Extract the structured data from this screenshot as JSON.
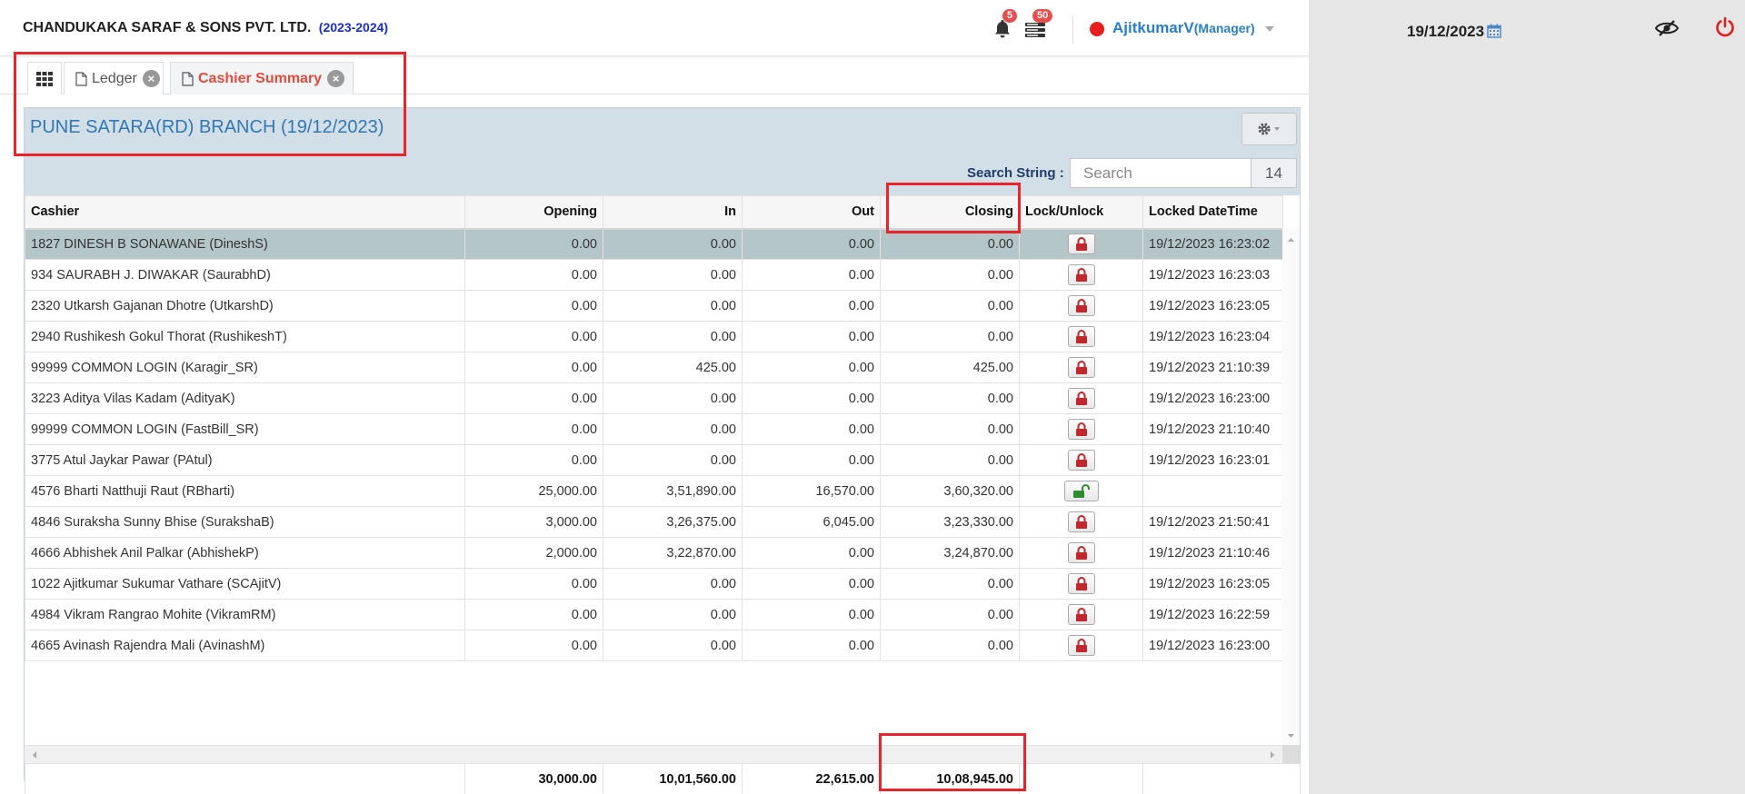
{
  "header": {
    "company": "CHANDUKAKA SARAF & SONS PVT. LTD.",
    "year": "(2023-2024)",
    "notifications_count": "5",
    "messages_count": "50",
    "user_name": "AjitkumarV",
    "user_role": "(Manager)"
  },
  "right_pane": {
    "date": "19/12/2023"
  },
  "tabs": [
    {
      "label": ""
    },
    {
      "label": "Ledger"
    },
    {
      "label": "Cashier Summary"
    }
  ],
  "panel": {
    "title": "PUNE SATARA(RD) BRANCH (19/12/2023)",
    "search_label": "Search String :",
    "search_placeholder": "Search",
    "search_count": "14"
  },
  "table": {
    "columns": [
      "Cashier",
      "Opening",
      "In",
      "Out",
      "Closing",
      "Lock/Unlock",
      "Locked DateTime"
    ],
    "rows": [
      {
        "cashier": "1827 DINESH B SONAWANE (DineshS)",
        "opening": "0.00",
        "in": "0.00",
        "out": "0.00",
        "closing": "0.00",
        "lock": "locked",
        "locked_datetime": "19/12/2023 16:23:02"
      },
      {
        "cashier": "934 SAURABH J. DIWAKAR (SaurabhD)",
        "opening": "0.00",
        "in": "0.00",
        "out": "0.00",
        "closing": "0.00",
        "lock": "locked",
        "locked_datetime": "19/12/2023 16:23:03"
      },
      {
        "cashier": "2320 Utkarsh Gajanan Dhotre (UtkarshD)",
        "opening": "0.00",
        "in": "0.00",
        "out": "0.00",
        "closing": "0.00",
        "lock": "locked",
        "locked_datetime": "19/12/2023 16:23:05"
      },
      {
        "cashier": "2940 Rushikesh Gokul Thorat (RushikeshT)",
        "opening": "0.00",
        "in": "0.00",
        "out": "0.00",
        "closing": "0.00",
        "lock": "locked",
        "locked_datetime": "19/12/2023 16:23:04"
      },
      {
        "cashier": "99999 COMMON LOGIN (Karagir_SR)",
        "opening": "0.00",
        "in": "425.00",
        "out": "0.00",
        "closing": "425.00",
        "lock": "locked",
        "locked_datetime": "19/12/2023 21:10:39"
      },
      {
        "cashier": "3223 Aditya Vilas Kadam (AdityaK)",
        "opening": "0.00",
        "in": "0.00",
        "out": "0.00",
        "closing": "0.00",
        "lock": "locked",
        "locked_datetime": "19/12/2023 16:23:00"
      },
      {
        "cashier": "99999 COMMON LOGIN (FastBill_SR)",
        "opening": "0.00",
        "in": "0.00",
        "out": "0.00",
        "closing": "0.00",
        "lock": "locked",
        "locked_datetime": "19/12/2023 21:10:40"
      },
      {
        "cashier": "3775 Atul Jaykar Pawar (PAtul)",
        "opening": "0.00",
        "in": "0.00",
        "out": "0.00",
        "closing": "0.00",
        "lock": "locked",
        "locked_datetime": "19/12/2023 16:23:01"
      },
      {
        "cashier": "4576 Bharti Natthuji Raut (RBharti)",
        "opening": "25,000.00",
        "in": "3,51,890.00",
        "out": "16,570.00",
        "closing": "3,60,320.00",
        "lock": "unlocked",
        "locked_datetime": ""
      },
      {
        "cashier": "4846 Suraksha Sunny Bhise (SurakshaB)",
        "opening": "3,000.00",
        "in": "3,26,375.00",
        "out": "6,045.00",
        "closing": "3,23,330.00",
        "lock": "locked",
        "locked_datetime": "19/12/2023 21:50:41"
      },
      {
        "cashier": "4666 Abhishek Anil Palkar (AbhishekP)",
        "opening": "2,000.00",
        "in": "3,22,870.00",
        "out": "0.00",
        "closing": "3,24,870.00",
        "lock": "locked",
        "locked_datetime": "19/12/2023 21:10:46"
      },
      {
        "cashier": "1022 Ajitkumar Sukumar Vathare (SCAjitV)",
        "opening": "0.00",
        "in": "0.00",
        "out": "0.00",
        "closing": "0.00",
        "lock": "locked",
        "locked_datetime": "19/12/2023 16:23:05"
      },
      {
        "cashier": "4984 Vikram Rangrao Mohite (VikramRM)",
        "opening": "0.00",
        "in": "0.00",
        "out": "0.00",
        "closing": "0.00",
        "lock": "locked",
        "locked_datetime": "19/12/2023 16:22:59"
      },
      {
        "cashier": "4665 Avinash Rajendra Mali (AvinashM)",
        "opening": "0.00",
        "in": "0.00",
        "out": "0.00",
        "closing": "0.00",
        "lock": "locked",
        "locked_datetime": "19/12/2023 16:23:00"
      }
    ],
    "totals": {
      "opening": "30,000.00",
      "in": "10,01,560.00",
      "out": "22,615.00",
      "closing": "10,08,945.00"
    }
  },
  "colors": {
    "accent_blue": "#3177b6",
    "active_tab": "#e34b3c",
    "highlight_red": "#e8242c",
    "lock_red": "#c0282e",
    "unlock_green": "#2e8b2e"
  },
  "icons": [
    "bell-icon",
    "messages-icon",
    "calendar-icon",
    "eye-slash-icon",
    "power-icon",
    "grid-icon",
    "document-icon",
    "close-icon",
    "gear-icon",
    "lock-icon",
    "unlock-icon"
  ]
}
